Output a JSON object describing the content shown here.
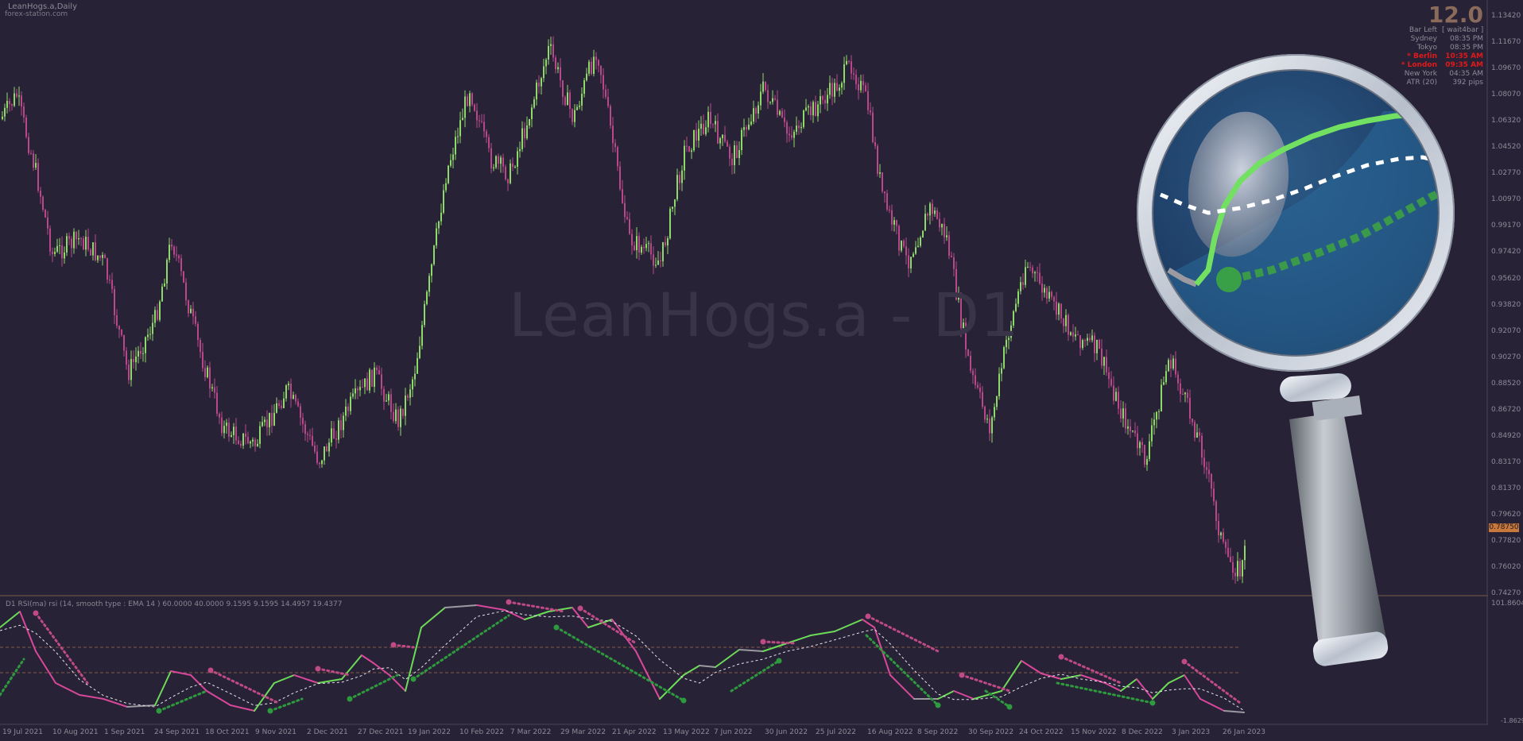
{
  "chart": {
    "title": "LeanHogs.a,Daily",
    "site": "forex-station.com",
    "watermark": "LeanHogs.a - D1",
    "current_price": "0.78750",
    "y_ticks": [
      "1.13420",
      "1.11670",
      "1.09670",
      "1.08070",
      "1.06320",
      "1.04520",
      "1.02770",
      "1.00970",
      "0.99170",
      "0.97420",
      "0.95620",
      "0.93820",
      "0.92070",
      "0.90270",
      "0.88520",
      "0.86720",
      "0.84920",
      "0.83170",
      "0.81370",
      "0.79620",
      "0.77820",
      "0.76020",
      "0.74270"
    ],
    "x_ticks": [
      "19 Jul 2021",
      "10 Aug 2021",
      "1 Sep 2021",
      "24 Sep 2021",
      "18 Oct 2021",
      "9 Nov 2021",
      "2 Dec 2021",
      "27 Dec 2021",
      "19 Jan 2022",
      "10 Feb 2022",
      "7 Mar 2022",
      "29 Mar 2022",
      "21 Apr 2022",
      "13 May 2022",
      "7 Jun 2022",
      "30 Jun 2022",
      "25 Jul 2022",
      "16 Aug 2022",
      "8 Sep 2022",
      "30 Sep 2022",
      "24 Oct 2022",
      "15 Nov 2022",
      "8 Dec 2022",
      "3 Jan 2023",
      "26 Jan 2023"
    ]
  },
  "info_panel": {
    "big_value": "12.0",
    "rows": [
      {
        "label": "Bar Left",
        "value": "[ wait4bar ]",
        "highlight": false
      },
      {
        "label": "Sydney",
        "value": "08:35 PM",
        "highlight": false
      },
      {
        "label": "Tokyo",
        "value": "08:35 PM",
        "highlight": false
      },
      {
        "label": "* Berlin",
        "value": "10:35 AM",
        "highlight": true
      },
      {
        "label": "* London",
        "value": "09:35 AM",
        "highlight": true
      },
      {
        "label": "New York",
        "value": "04:35 AM",
        "highlight": false
      },
      {
        "label": "ATR (20)",
        "value": "392 pips",
        "highlight": false
      }
    ]
  },
  "indicator": {
    "title": "D1 RSI(ma) rsi (14, smooth type : EMA  14 ) 60.0000 40.0000 9.1595 9.1595 14.4957 19.4377",
    "y_max": "101.8604",
    "y_min": "-1.8629"
  },
  "colors": {
    "background": "#282236",
    "bull_candle": "#8fd86a",
    "bear_candle": "#b8488a",
    "rsi_green": "#6cdc58",
    "rsi_pink": "#d8489a",
    "rsi_gray": "#9a9aa0",
    "signal_green": "#2e9a3e",
    "signal_pink": "#c04a86",
    "separator": "#7a5a4a"
  }
}
